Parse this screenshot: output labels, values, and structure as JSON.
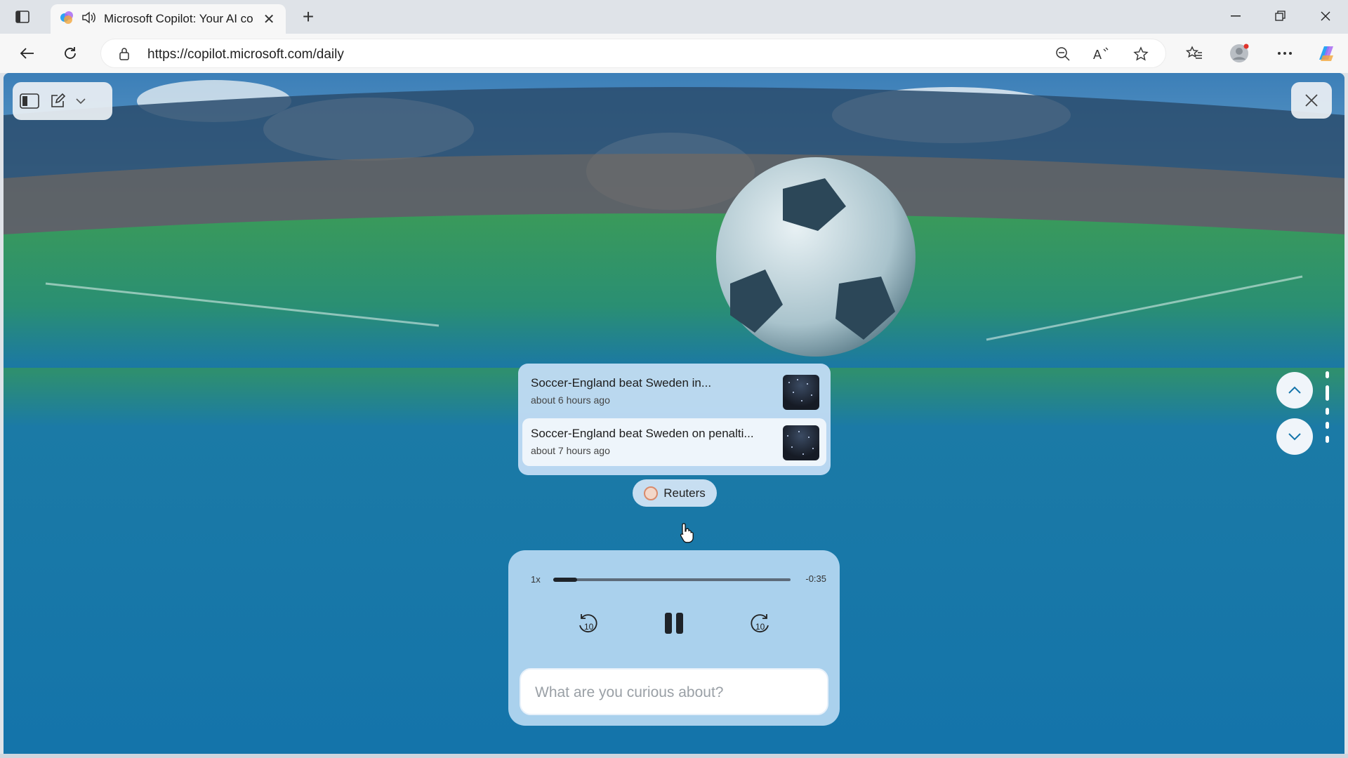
{
  "browser": {
    "tab": {
      "title": "Microsoft Copilot: Your AI co"
    },
    "url": "https://copilot.microsoft.com/daily"
  },
  "news": [
    {
      "title": "Soccer-England beat Sweden in...",
      "time": "about 6 hours ago"
    },
    {
      "title": "Soccer-England beat Sweden on penalti...",
      "time": "about 7 hours ago"
    }
  ],
  "source": {
    "label": "Reuters"
  },
  "player": {
    "speed": "1x",
    "remaining": "-0:35",
    "progress_fraction": 0.1,
    "rewind_label": "10",
    "forward_label": "10"
  },
  "ask": {
    "placeholder": "What are you curious about?"
  },
  "colors": {
    "accent": "#1474aa",
    "copilot_gradient": [
      "#2aa4f4",
      "#a86bf2",
      "#f3a63b"
    ]
  }
}
